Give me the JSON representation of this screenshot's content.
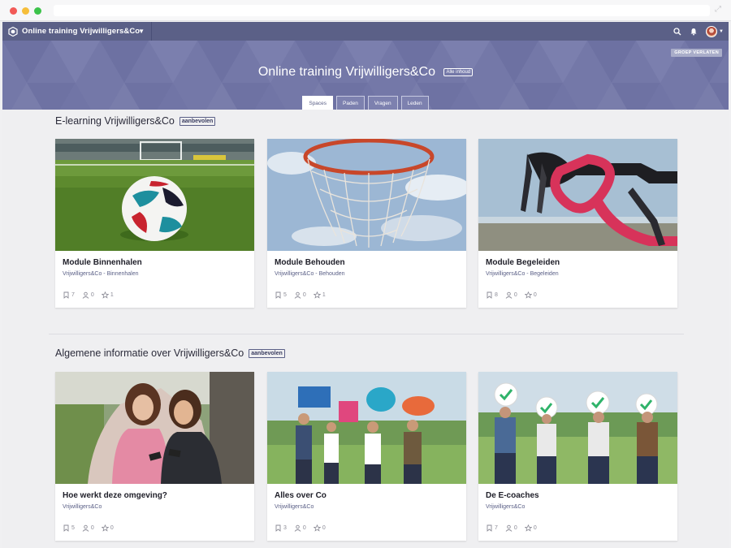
{
  "header": {
    "group_name": "Online training Vrijwilligers&Co"
  },
  "hero": {
    "title": "Online training Vrijwilligers&Co",
    "badge": "Alle inhoud",
    "leave_button": "GROEP VERLATEN",
    "tabs": [
      {
        "label": "Spaces",
        "active": true
      },
      {
        "label": "Paden",
        "active": false
      },
      {
        "label": "Vragen",
        "active": false
      },
      {
        "label": "Leden",
        "active": false
      }
    ]
  },
  "sections": [
    {
      "title": "E-learning Vrijwilligers&Co",
      "badge": "aanbevolen",
      "cards": [
        {
          "title": "Module Binnenhalen",
          "subtitle": "Vrijwilligers&Co - Binnenhalen",
          "pages": "7",
          "members": "0",
          "stars": "1",
          "image": "soccer-ball"
        },
        {
          "title": "Module Behouden",
          "subtitle": "Vrijwilligers&Co - Behouden",
          "pages": "5",
          "members": "0",
          "stars": "1",
          "image": "basketball-hoop"
        },
        {
          "title": "Module Begeleiden",
          "subtitle": "Vrijwilligers&Co - Begeleiden",
          "pages": "8",
          "members": "0",
          "stars": "0",
          "image": "bicycle-handlebar"
        }
      ]
    },
    {
      "title": "Algemene informatie over Vrijwilligers&Co",
      "badge": "aanbevolen",
      "cards": [
        {
          "title": "Hoe werkt deze omgeving?",
          "subtitle": "Vrijwilligers&Co",
          "pages": "5",
          "members": "0",
          "stars": "0",
          "image": "girls-with-phones"
        },
        {
          "title": "Alles over Co",
          "subtitle": "Vrijwilligers&Co",
          "pages": "3",
          "members": "0",
          "stars": "0",
          "image": "people-speech-bubbles"
        },
        {
          "title": "De E-coaches",
          "subtitle": "Vrijwilligers&Co",
          "pages": "7",
          "members": "0",
          "stars": "0",
          "image": "people-checkmark-signs"
        }
      ]
    }
  ],
  "colors": {
    "nav": "#5b6087",
    "hero": "#7478a8",
    "accent": "#5b6087"
  }
}
